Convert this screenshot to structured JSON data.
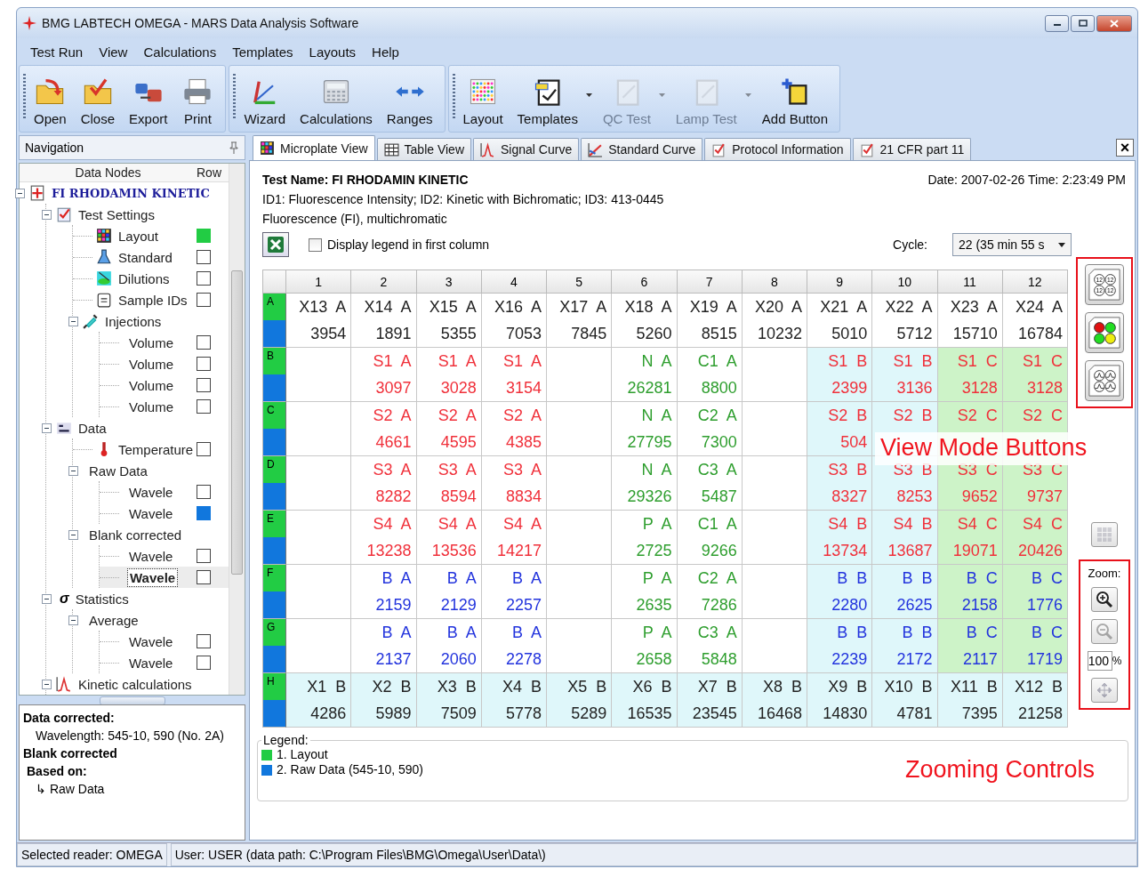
{
  "window": {
    "title": "BMG LABTECH  OMEGA - MARS Data Analysis Software"
  },
  "menu": [
    "Test Run",
    "View",
    "Calculations",
    "Templates",
    "Layouts",
    "Help"
  ],
  "toolbar": [
    {
      "buttons": [
        {
          "label": "Open",
          "disabled": false,
          "dropdown": false
        },
        {
          "label": "Close",
          "disabled": false,
          "dropdown": false
        },
        {
          "label": "Export",
          "disabled": false,
          "dropdown": false
        },
        {
          "label": "Print",
          "disabled": false,
          "dropdown": false
        }
      ]
    },
    {
      "buttons": [
        {
          "label": "Wizard",
          "disabled": false,
          "dropdown": false
        },
        {
          "label": "Calculations",
          "disabled": false,
          "dropdown": false
        },
        {
          "label": "Ranges",
          "disabled": false,
          "dropdown": false
        }
      ]
    },
    {
      "buttons": [
        {
          "label": "Layout",
          "disabled": false,
          "dropdown": false
        },
        {
          "label": "Templates",
          "disabled": false,
          "dropdown": true
        },
        {
          "label": "QC Test",
          "disabled": true,
          "dropdown": true
        },
        {
          "label": "Lamp Test",
          "disabled": true,
          "dropdown": true
        },
        {
          "label": "Add Button",
          "disabled": false,
          "dropdown": false
        }
      ]
    }
  ],
  "navigation": {
    "title": "Navigation",
    "columns": [
      "Data Nodes",
      "Row"
    ],
    "tree": [
      {
        "label": "FI RHODAMIN KINETIC",
        "expanded": true,
        "selected": false,
        "children": [
          {
            "label": "Test Settings",
            "expanded": true,
            "selected": false,
            "children": [
              {
                "label": "Layout",
                "marker": true,
                "color": "#22cc44",
                "selected": false
              },
              {
                "label": "Standard",
                "marker": true,
                "selected": false
              },
              {
                "label": "Dilutions",
                "marker": true,
                "selected": false
              },
              {
                "label": "Sample IDs",
                "marker": true,
                "selected": false
              },
              {
                "label": "Injections",
                "expanded": true,
                "selected": false,
                "children": [
                  {
                    "label": "Volume",
                    "marker": true,
                    "selected": false
                  },
                  {
                    "label": "Volume",
                    "marker": true,
                    "selected": false
                  },
                  {
                    "label": "Volume",
                    "marker": true,
                    "selected": false
                  },
                  {
                    "label": "Volume",
                    "marker": true,
                    "selected": false
                  }
                ]
              }
            ]
          },
          {
            "label": "Data",
            "expanded": true,
            "selected": false,
            "children": [
              {
                "label": "Temperature",
                "marker": true,
                "selected": false
              },
              {
                "label": "Raw Data",
                "expanded": true,
                "selected": false,
                "children": [
                  {
                    "label": "Wavele",
                    "marker": true,
                    "selected": false
                  },
                  {
                    "label": "Wavele",
                    "marker": true,
                    "color": "#1177dd",
                    "selected": false
                  }
                ]
              },
              {
                "label": "Blank corrected",
                "expanded": true,
                "selected": false,
                "children": [
                  {
                    "label": "Wavele",
                    "marker": true,
                    "selected": false
                  },
                  {
                    "label": "Wavele",
                    "marker": true,
                    "selected": true
                  }
                ]
              }
            ]
          },
          {
            "label": "Statistics",
            "glyph": "σ",
            "expanded": true,
            "selected": false,
            "children": [
              {
                "label": "Average",
                "expanded": true,
                "selected": false,
                "children": [
                  {
                    "label": "Wavele",
                    "marker": true,
                    "selected": false
                  },
                  {
                    "label": "Wavele",
                    "marker": true,
                    "selected": false
                  }
                ]
              }
            ]
          },
          {
            "label": "Kinetic calculations",
            "expanded": true,
            "selected": false
          }
        ]
      }
    ],
    "info": [
      {
        "kind": "heading",
        "text": "Data corrected:"
      },
      {
        "kind": "detail",
        "text": "Wavelength: 545-10, 590 (No. 2A)"
      },
      {
        "kind": "heading",
        "text": "Blank corrected"
      },
      {
        "kind": "subheading",
        "text": "Based on:"
      },
      {
        "kind": "detail",
        "text": "↳ Raw Data"
      }
    ]
  },
  "tabs": [
    {
      "label": "Microplate View",
      "selected": true
    },
    {
      "label": "Table View",
      "selected": false
    },
    {
      "label": "Signal Curve",
      "selected": false
    },
    {
      "label": "Standard Curve",
      "selected": false
    },
    {
      "label": "Protocol Information",
      "selected": false
    },
    {
      "label": "21 CFR part 11",
      "selected": false
    }
  ],
  "close_button": "×",
  "test_info": {
    "name": "Test Name: FI RHODAMIN KINETIC",
    "date": "Date: 2007-02-26  Time: 2:23:49 PM",
    "lines": [
      "ID1: Fluorescence Intensity; ID2: Kinetic with Bichromatic; ID3: 413-0445",
      "Fluorescence (FI), multichromatic"
    ]
  },
  "options": {
    "legend_checkbox": {
      "label": "Display legend in first column",
      "checked": false
    },
    "cycle_label": "Cycle:",
    "cycle_value": "22 (35 min 55 s"
  },
  "plate": {
    "columns": [
      "1",
      "2",
      "3",
      "4",
      "5",
      "6",
      "7",
      "8",
      "9",
      "10",
      "11",
      "12"
    ],
    "rows": [
      {
        "label": "A",
        "cells": [
          {
            "id": "X13 A",
            "value": "3954",
            "kind": "unknown",
            "color": "#ffffff"
          },
          {
            "id": "X14 A",
            "value": "1891",
            "kind": "unknown",
            "color": "#ffffff"
          },
          {
            "id": "X15 A",
            "value": "5355",
            "kind": "unknown",
            "color": "#ffffff"
          },
          {
            "id": "X16 A",
            "value": "7053",
            "kind": "unknown",
            "color": "#ffffff"
          },
          {
            "id": "X17 A",
            "value": "7845",
            "kind": "unknown",
            "color": "#ffffff"
          },
          {
            "id": "X18 A",
            "value": "5260",
            "kind": "unknown",
            "color": "#ffffff"
          },
          {
            "id": "X19 A",
            "value": "8515",
            "kind": "unknown",
            "color": "#ffffff"
          },
          {
            "id": "X20 A",
            "value": "10232",
            "kind": "unknown",
            "color": "#ffffff"
          },
          {
            "id": "X21 A",
            "value": "5010",
            "kind": "unknown",
            "color": "#ffffff"
          },
          {
            "id": "X22 A",
            "value": "5712",
            "kind": "unknown",
            "color": "#ffffff"
          },
          {
            "id": "X23 A",
            "value": "15710",
            "kind": "unknown",
            "color": "#ffffff"
          },
          {
            "id": "X24 A",
            "value": "16784",
            "kind": "unknown",
            "color": "#ffffff"
          }
        ]
      },
      {
        "label": "B",
        "cells": [
          {
            "kind": "empty"
          },
          {
            "id": "S1 A",
            "value": "3097",
            "kind": "standard",
            "color": "#ffffff"
          },
          {
            "id": "S1 A",
            "value": "3028",
            "kind": "standard",
            "color": "#ffffff"
          },
          {
            "id": "S1 A",
            "value": "3154",
            "kind": "standard",
            "color": "#ffffff"
          },
          {
            "kind": "empty"
          },
          {
            "id": "N A",
            "value": "26281",
            "kind": "negative",
            "color": "#ffffff"
          },
          {
            "id": "C1 A",
            "value": "8800",
            "kind": "control",
            "color": "#ffffff"
          },
          {
            "kind": "empty"
          },
          {
            "id": "S1 B",
            "value": "2399",
            "kind": "standard",
            "color": "#dff7fa"
          },
          {
            "id": "S1 B",
            "value": "3136",
            "kind": "standard",
            "color": "#dff7fa"
          },
          {
            "id": "S1 C",
            "value": "3128",
            "kind": "standard",
            "color": "#cdf3c8"
          },
          {
            "id": "S1 C",
            "value": "3128",
            "kind": "standard",
            "color": "#cdf3c8"
          }
        ]
      },
      {
        "label": "C",
        "cells": [
          {
            "kind": "empty"
          },
          {
            "id": "S2 A",
            "value": "4661",
            "kind": "standard",
            "color": "#ffffff"
          },
          {
            "id": "S2 A",
            "value": "4595",
            "kind": "standard",
            "color": "#ffffff"
          },
          {
            "id": "S2 A",
            "value": "4385",
            "kind": "standard",
            "color": "#ffffff"
          },
          {
            "kind": "empty"
          },
          {
            "id": "N A",
            "value": "27795",
            "kind": "negative",
            "color": "#ffffff"
          },
          {
            "id": "C2 A",
            "value": "7300",
            "kind": "control",
            "color": "#ffffff"
          },
          {
            "kind": "empty"
          },
          {
            "id": "S2 B",
            "value": "504",
            "kind": "standard",
            "color": "#dff7fa"
          },
          {
            "id": "S2 B",
            "kind": "standard",
            "color": "#dff7fa"
          },
          {
            "id": "S2 C",
            "kind": "standard",
            "color": "#cdf3c8"
          },
          {
            "id": "S2 C",
            "kind": "standard",
            "color": "#cdf3c8"
          }
        ]
      },
      {
        "label": "D",
        "cells": [
          {
            "kind": "empty"
          },
          {
            "id": "S3 A",
            "value": "8282",
            "kind": "standard",
            "color": "#ffffff"
          },
          {
            "id": "S3 A",
            "value": "8594",
            "kind": "standard",
            "color": "#ffffff"
          },
          {
            "id": "S3 A",
            "value": "8834",
            "kind": "standard",
            "color": "#ffffff"
          },
          {
            "kind": "empty"
          },
          {
            "id": "N A",
            "value": "29326",
            "kind": "negative",
            "color": "#ffffff"
          },
          {
            "id": "C3 A",
            "value": "5487",
            "kind": "control",
            "color": "#ffffff"
          },
          {
            "kind": "empty"
          },
          {
            "id": "S3 B",
            "value": "8327",
            "kind": "standard",
            "color": "#dff7fa"
          },
          {
            "id": "S3 B",
            "value": "8253",
            "kind": "standard",
            "color": "#dff7fa"
          },
          {
            "id": "S3 C",
            "value": "9652",
            "kind": "standard",
            "color": "#cdf3c8"
          },
          {
            "id": "S3 C",
            "value": "9737",
            "kind": "standard",
            "color": "#cdf3c8"
          }
        ]
      },
      {
        "label": "E",
        "cells": [
          {
            "kind": "empty"
          },
          {
            "id": "S4 A",
            "value": "13238",
            "kind": "standard",
            "color": "#ffffff"
          },
          {
            "id": "S4 A",
            "value": "13536",
            "kind": "standard",
            "color": "#ffffff"
          },
          {
            "id": "S4 A",
            "value": "14217",
            "kind": "standard",
            "color": "#ffffff"
          },
          {
            "kind": "empty"
          },
          {
            "id": "P A",
            "value": "2725",
            "kind": "positive",
            "color": "#ffffff"
          },
          {
            "id": "C1 A",
            "value": "9266",
            "kind": "control",
            "color": "#ffffff"
          },
          {
            "kind": "empty"
          },
          {
            "id": "S4 B",
            "value": "13734",
            "kind": "standard",
            "color": "#dff7fa"
          },
          {
            "id": "S4 B",
            "value": "13687",
            "kind": "standard",
            "color": "#dff7fa"
          },
          {
            "id": "S4 C",
            "value": "19071",
            "kind": "standard",
            "color": "#cdf3c8"
          },
          {
            "id": "S4 C",
            "value": "20426",
            "kind": "standard",
            "color": "#cdf3c8"
          }
        ]
      },
      {
        "label": "F",
        "cells": [
          {
            "kind": "empty"
          },
          {
            "id": "B A",
            "value": "2159",
            "kind": "blank",
            "color": "#ffffff"
          },
          {
            "id": "B A",
            "value": "2129",
            "kind": "blank",
            "color": "#ffffff"
          },
          {
            "id": "B A",
            "value": "2257",
            "kind": "blank",
            "color": "#ffffff"
          },
          {
            "kind": "empty"
          },
          {
            "id": "P A",
            "value": "2635",
            "kind": "positive",
            "color": "#ffffff"
          },
          {
            "id": "C2 A",
            "value": "7286",
            "kind": "control",
            "color": "#ffffff"
          },
          {
            "kind": "empty"
          },
          {
            "id": "B B",
            "value": "2280",
            "kind": "blank",
            "color": "#dff7fa"
          },
          {
            "id": "B B",
            "value": "2625",
            "kind": "blank",
            "color": "#dff7fa"
          },
          {
            "id": "B C",
            "value": "2158",
            "kind": "blank",
            "color": "#cdf3c8"
          },
          {
            "id": "B C",
            "value": "1776",
            "kind": "blank",
            "color": "#cdf3c8"
          }
        ]
      },
      {
        "label": "G",
        "cells": [
          {
            "kind": "empty"
          },
          {
            "id": "B A",
            "value": "2137",
            "kind": "blank",
            "color": "#ffffff"
          },
          {
            "id": "B A",
            "value": "2060",
            "kind": "blank",
            "color": "#ffffff"
          },
          {
            "id": "B A",
            "value": "2278",
            "kind": "blank",
            "color": "#ffffff"
          },
          {
            "kind": "empty"
          },
          {
            "id": "P A",
            "value": "2658",
            "kind": "positive",
            "color": "#ffffff"
          },
          {
            "id": "C3 A",
            "value": "5848",
            "kind": "control",
            "color": "#ffffff"
          },
          {
            "kind": "empty"
          },
          {
            "id": "B B",
            "value": "2239",
            "kind": "blank",
            "color": "#dff7fa"
          },
          {
            "id": "B B",
            "value": "2172",
            "kind": "blank",
            "color": "#dff7fa"
          },
          {
            "id": "B C",
            "value": "2117",
            "kind": "blank",
            "color": "#cdf3c8"
          },
          {
            "id": "B C",
            "value": "1719",
            "kind": "blank",
            "color": "#cdf3c8"
          }
        ]
      },
      {
        "label": "H",
        "cells": [
          {
            "id": "X1 B",
            "value": "4286",
            "kind": "unknown",
            "color": "#dff7fa"
          },
          {
            "id": "X2 B",
            "value": "5989",
            "kind": "unknown",
            "color": "#dff7fa"
          },
          {
            "id": "X3 B",
            "value": "7509",
            "kind": "unknown",
            "color": "#dff7fa"
          },
          {
            "id": "X4 B",
            "value": "5778",
            "kind": "unknown",
            "color": "#dff7fa"
          },
          {
            "id": "X5 B",
            "value": "5289",
            "kind": "unknown",
            "color": "#dff7fa"
          },
          {
            "id": "X6 B",
            "value": "16535",
            "kind": "unknown",
            "color": "#dff7fa"
          },
          {
            "id": "X7 B",
            "value": "23545",
            "kind": "unknown",
            "color": "#dff7fa"
          },
          {
            "id": "X8 B",
            "value": "16468",
            "kind": "unknown",
            "color": "#dff7fa"
          },
          {
            "id": "X9 B",
            "value": "14830",
            "kind": "unknown",
            "color": "#dff7fa"
          },
          {
            "id": "X10 B",
            "value": "4781",
            "kind": "unknown",
            "color": "#dff7fa"
          },
          {
            "id": "X11 B",
            "value": "7395",
            "kind": "unknown",
            "color": "#dff7fa"
          },
          {
            "id": "X12 B",
            "value": "21258",
            "kind": "unknown",
            "color": "#dff7fa"
          }
        ]
      }
    ]
  },
  "legend": {
    "title": "Legend:",
    "items": [
      {
        "label": "1. Layout",
        "color": "#22cc44"
      },
      {
        "label": "2. Raw Data (545-10, 590)",
        "color": "#1177dd"
      }
    ]
  },
  "view_modes": [
    {
      "kind": "numbers",
      "texts": [
        "12",
        "12",
        "12",
        "12"
      ]
    },
    {
      "kind": "traffic"
    },
    {
      "kind": "curves"
    }
  ],
  "grid_button": {
    "disabled": true
  },
  "zoom": {
    "label": "Zoom:",
    "zoom_in": {
      "disabled": false
    },
    "zoom_out": {
      "disabled": true
    },
    "value": "100",
    "unit": "%",
    "pan": {
      "disabled": true
    }
  },
  "annotations": [
    "View Mode Buttons",
    "Zooming Controls"
  ],
  "status_bar": [
    "Selected reader: OMEGA",
    "User: USER  (data path: C:\\Program Files\\BMG\\Omega\\User\\Data\\)"
  ]
}
